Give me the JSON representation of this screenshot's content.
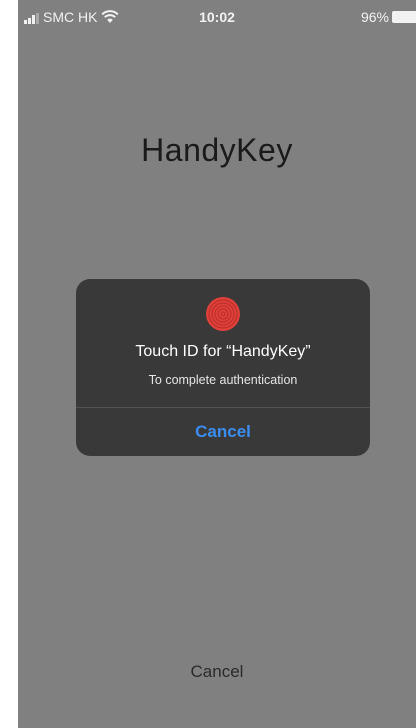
{
  "status_bar": {
    "carrier": "SMC HK",
    "time": "10:02",
    "battery_percent": "96%",
    "icons": [
      "signal-icon",
      "wifi-icon",
      "battery-icon"
    ]
  },
  "app": {
    "title": "HandyKey"
  },
  "dialog": {
    "icon": "fingerprint-icon",
    "title": "Touch ID for “HandyKey”",
    "message": "To complete authentication",
    "cancel_label": "Cancel"
  },
  "footer": {
    "cancel_label": "Cancel"
  },
  "colors": {
    "background": "#808080",
    "dialog_background": "#393939",
    "accent": "#3b8df2",
    "fingerprint": "#e0403a"
  }
}
